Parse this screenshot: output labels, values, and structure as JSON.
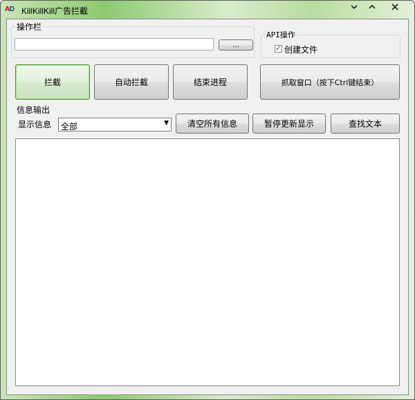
{
  "window": {
    "title": "KillKillKill广告拦截",
    "icon_text_a": "A",
    "icon_text_d": "D"
  },
  "operations": {
    "group_label": "操作栏",
    "path_value": "",
    "browse_label": "..."
  },
  "api": {
    "group_label": "API操作",
    "create_file_label": "创建文件",
    "create_file_checked": true
  },
  "buttons": {
    "intercept": "拦截",
    "auto_intercept": "自动拦截",
    "end_process": "结束进程",
    "grab_window": "抓取窗口（按下Ctrl键结束）"
  },
  "info": {
    "group_label": "信息输出",
    "show_label": "显示信息",
    "filter_value": "全部",
    "clear_all": "清空所有信息",
    "pause_display": "暂停更新显示",
    "find_text": "查找文本",
    "output_text": ""
  }
}
